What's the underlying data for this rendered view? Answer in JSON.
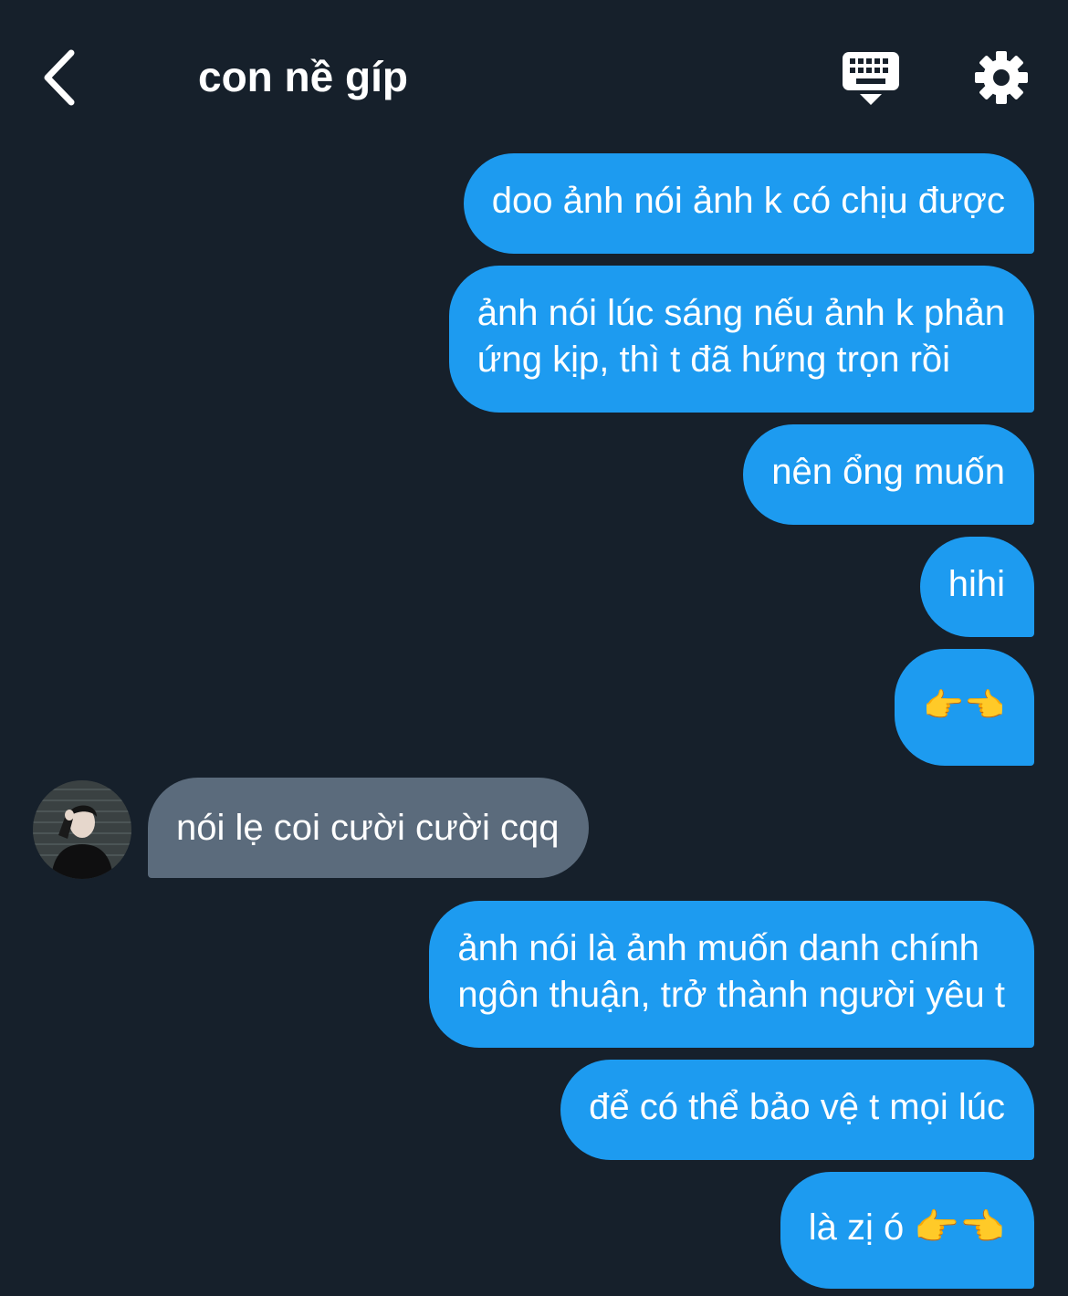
{
  "header": {
    "title": "con nề gíp",
    "back_icon": "chevron-left-icon",
    "keyboard_icon": "keyboard-hide-icon",
    "settings_icon": "gear-icon"
  },
  "colors": {
    "background": "#16202b",
    "outgoing_bubble": "#1d9bf0",
    "incoming_bubble": "#5b6b7c",
    "text": "#ffffff"
  },
  "messages": [
    {
      "direction": "out",
      "text": "doo ảnh nói ảnh k có chịu được"
    },
    {
      "direction": "out",
      "text": "ảnh nói lúc sáng nếu ảnh k phản\nứng kịp, thì t đã hứng trọn rồi"
    },
    {
      "direction": "out",
      "text": "nên ổng muốn"
    },
    {
      "direction": "out",
      "text": "hihi"
    },
    {
      "direction": "out",
      "text": "👉👈"
    },
    {
      "direction": "in",
      "text": "nói lẹ coi cười cười cqq"
    },
    {
      "direction": "out",
      "text": "ảnh nói là ảnh muốn danh chính\nngôn thuận, trở thành người yêu t"
    },
    {
      "direction": "out",
      "text": "để có thể bảo vệ t mọi lúc"
    },
    {
      "direction": "out",
      "text": "là zị ó 👉👈"
    }
  ]
}
